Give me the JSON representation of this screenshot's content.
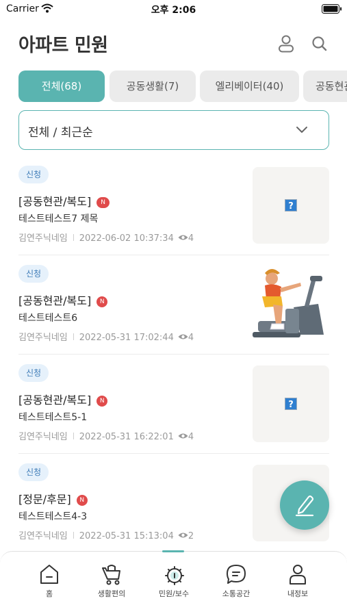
{
  "status_bar": {
    "carrier": "Carrier",
    "time": "오후 2:06"
  },
  "header": {
    "title": "아파트 민원"
  },
  "tabs": [
    {
      "label": "전체(68)",
      "active": true
    },
    {
      "label": "공동생활(7)",
      "active": false
    },
    {
      "label": "엘리베이터(40)",
      "active": false
    },
    {
      "label": "공동현관",
      "active": false
    }
  ],
  "filter": {
    "value": "전체 / 최근순"
  },
  "items": [
    {
      "status": "신청",
      "category": "[공동현관/복도]",
      "new_badge": "N",
      "title": "테스트테스트7 제목",
      "author": "김연주닉네임",
      "datetime": "2022-06-02 10:37:34",
      "views": "4",
      "image": "broken-image-icon"
    },
    {
      "status": "신청",
      "category": "[공동현관/복도]",
      "new_badge": "N",
      "title": "테스트테스트6",
      "author": "김연주닉네임",
      "datetime": "2022-05-31 17:02:44",
      "views": "4",
      "image": "exercise-bike-photo"
    },
    {
      "status": "신청",
      "category": "[공동현관/복도]",
      "new_badge": "N",
      "title": "테스트테스트5-1",
      "author": "김연주닉네임",
      "datetime": "2022-05-31 16:22:01",
      "views": "4",
      "image": "broken-image-icon"
    },
    {
      "status": "신청",
      "category": "[정문/후문]",
      "new_badge": "N",
      "title": "테스트테스트4-3",
      "author": "김연주닉네임",
      "datetime": "2022-05-31 15:13:04",
      "views": "2",
      "image": "broken-image-icon"
    }
  ],
  "bottom_nav": [
    {
      "label": "홈",
      "icon": "home-icon",
      "active": false
    },
    {
      "label": "생활편의",
      "icon": "cart-icon",
      "active": false
    },
    {
      "label": "민원/보수",
      "icon": "complaint-gear-icon",
      "active": true
    },
    {
      "label": "소통공간",
      "icon": "chat-icon",
      "active": false
    },
    {
      "label": "내정보",
      "icon": "profile-icon",
      "active": false
    }
  ],
  "colors": {
    "accent": "#5ab4b0",
    "badge_bg": "#e6f1fb",
    "badge_text": "#3d7bb7",
    "new_badge": "#e04b4b"
  }
}
